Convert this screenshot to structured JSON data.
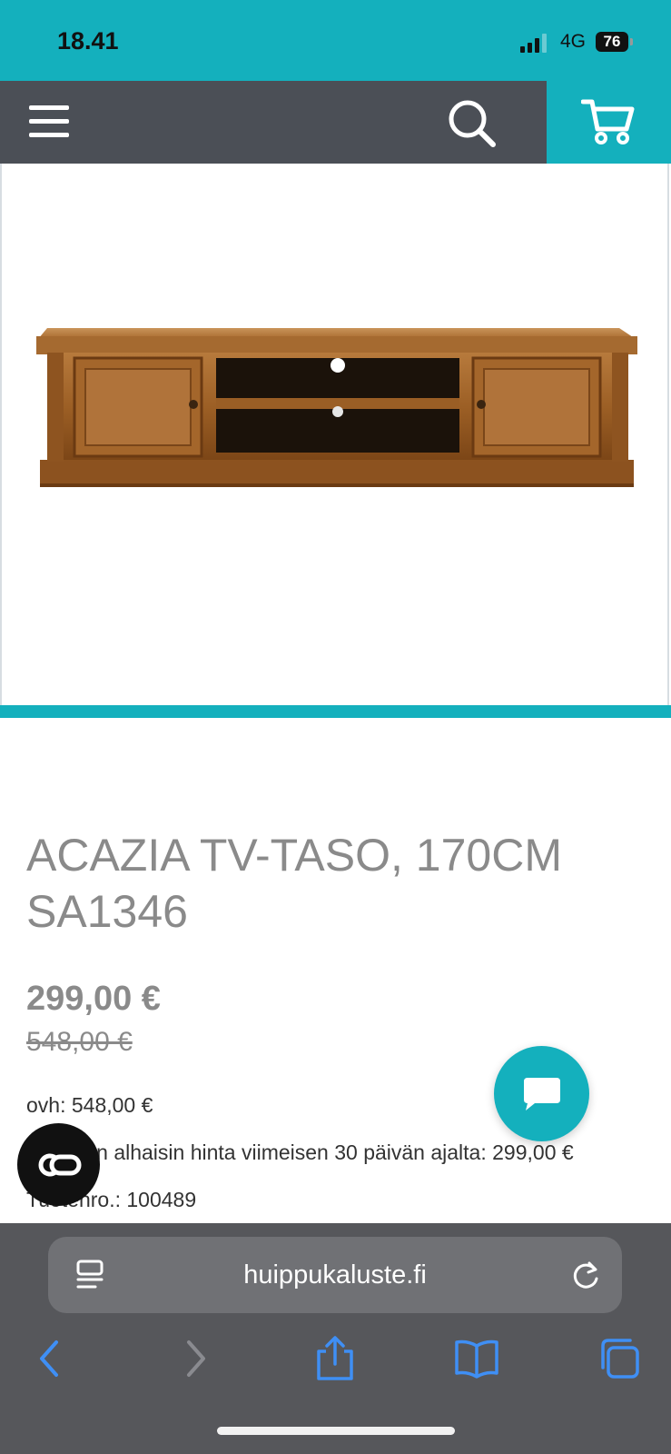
{
  "status": {
    "time": "18.41",
    "network": "4G",
    "battery": "76"
  },
  "product": {
    "title": "ACAZIA TV-TASO, 170CM SA1346",
    "price": "299,00 €",
    "old_price": "548,00 €",
    "rrp": "ovh: 548,00 €",
    "lowest_price": "Tuotteen alhaisin hinta viimeisen 30 päivän ajalta: 299,00 €",
    "product_number": "Tuotenro.: 100489"
  },
  "browser": {
    "url": "huippukaluste.fi"
  },
  "colors": {
    "accent": "#14b0bd",
    "header": "#4b4f56",
    "browser_bar": "#56575b",
    "toolbar_icon": "#3f8ff5"
  },
  "icons": [
    "menu-icon",
    "search-icon",
    "cart-icon",
    "chat-icon",
    "co-badge-icon",
    "reader-icon",
    "reload-icon",
    "back-icon",
    "forward-icon",
    "share-icon",
    "bookmarks-icon",
    "tabs-icon"
  ]
}
